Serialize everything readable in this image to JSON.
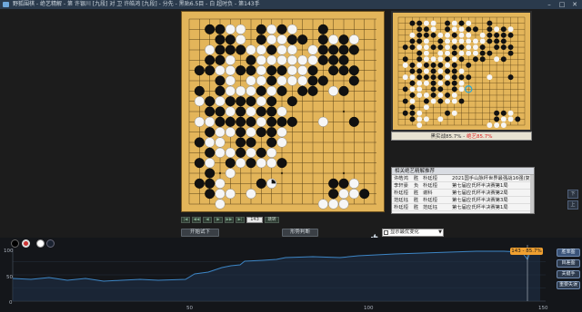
{
  "window": {
    "title": "野狐围棋 - 绝艺精解 - 第 许银川 [九段] 对 卫 许皓鸿 [九段] - 分先 - 黑贴6.5目 - 白 超时负 - 第143手",
    "controls": [
      "–",
      "□",
      "✕"
    ]
  },
  "analysis": {
    "winrate_text": "黑实战85.7%",
    "winrate_sep": "-",
    "winrate_ai": "绝艺85.7%"
  },
  "history": {
    "header": "相关绝艺精解推荐",
    "rows": [
      {
        "black": "许皓鸿",
        "result": "胜",
        "white": "朴廷桓",
        "event": "2021国手山脉杯世界最强战16强(复"
      },
      {
        "black": "李轩豪",
        "result": "负",
        "white": "朴廷桓",
        "event": "第七届应氏杯半决赛第1局"
      },
      {
        "black": "朴廷桓",
        "result": "胜",
        "white": "谢科",
        "event": "第七届应氏杯半决赛第2局"
      },
      {
        "black": "范廷钰",
        "result": "胜",
        "white": "朴廷桓",
        "event": "第七届应氏杯半决赛第3局"
      },
      {
        "black": "朴廷桓",
        "result": "胜",
        "white": "范廷钰",
        "event": "第七届应氏杯半决赛第1局"
      }
    ]
  },
  "nav": {
    "buttons": [
      "|◀",
      "◀◀",
      "◀",
      "▶",
      "▶▶",
      "▶|"
    ],
    "move_number": "143",
    "goto_label": "跳转"
  },
  "toolbar": {
    "feedback_label": "开始试下",
    "compare_label": "形势判断",
    "best_move_label": "显示最优变化",
    "best_move_arrow": "▼"
  },
  "side_tags": [
    "下",
    "上"
  ],
  "graph": {
    "tooltip": "143 - 85.7%",
    "y_ticks": [
      "100",
      "50",
      "0"
    ],
    "x_ticks": [
      "50",
      "100",
      "150"
    ]
  },
  "graph_buttons": [
    "胜率图",
    "目差图",
    "关键手",
    "重要失误"
  ],
  "colors": {
    "board": "#e3b55a",
    "curve": "#3d86c6",
    "tooltip_bg": "#f0a030",
    "accent_red": "#d22222"
  }
}
